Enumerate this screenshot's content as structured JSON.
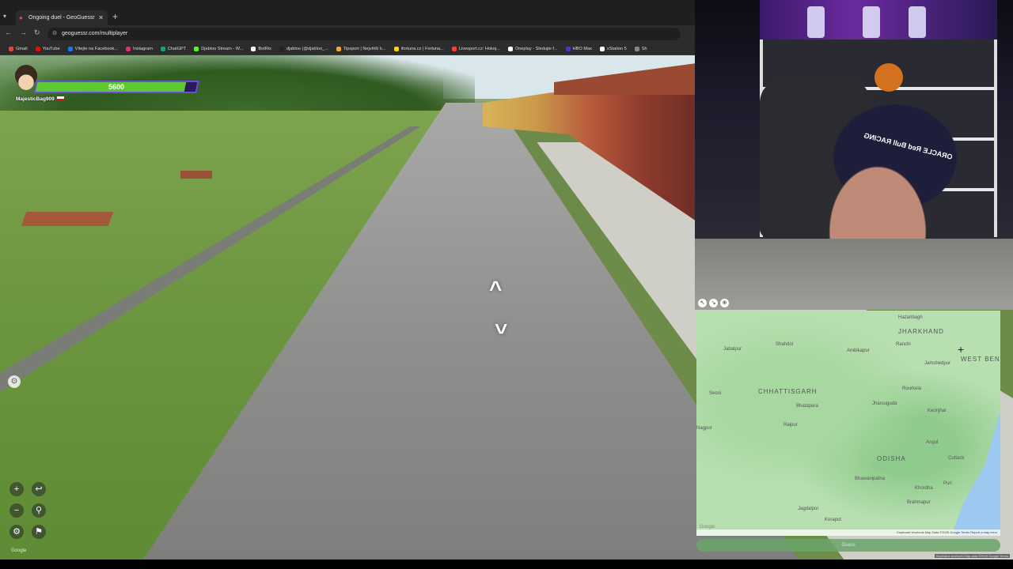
{
  "browser": {
    "tab_title": "Ongoing duel - GeoGuessr",
    "tab_close": "✕",
    "new_tab": "+",
    "url": "geoguessr.com/multiplayer",
    "bookmarks": [
      {
        "label": "Gmail",
        "color": "#ea4335"
      },
      {
        "label": "YouTube",
        "color": "#ff0000"
      },
      {
        "label": "Vítejte na Facebook...",
        "color": "#1877f2"
      },
      {
        "label": "Instagram",
        "color": "#e1306c"
      },
      {
        "label": "ChatGPT",
        "color": "#10a37f"
      },
      {
        "label": "Djabloo Stream - W...",
        "color": "#53fc18"
      },
      {
        "label": "BotRix",
        "color": "#ffffff"
      },
      {
        "label": "djabloo (@djabloo_...",
        "color": "#222222"
      },
      {
        "label": "Tipsport | Největší k...",
        "color": "#f5a623"
      },
      {
        "label": "ifortuna.cz | Fortuna...",
        "color": "#ffd200"
      },
      {
        "label": "Livesport.cz: Hokej...",
        "color": "#ff3b30"
      },
      {
        "label": "Oneplay - Sledujte f...",
        "color": "#ffffff"
      },
      {
        "label": "HBO Max",
        "color": "#5a2dd6"
      },
      {
        "label": "xStation 5",
        "color": "#ffffff"
      },
      {
        "label": "Sh",
        "color": "#888888"
      }
    ]
  },
  "hud": {
    "health_value": "5600",
    "health_fraction": 0.93,
    "player_name": "MajesticBag909",
    "colors": {
      "health_fill": "#5cc832",
      "bar_border": "#6b4dd6"
    }
  },
  "webcam": {
    "cap_text": "ORACLE Red Bull RACING"
  },
  "map": {
    "labels": [
      {
        "text": "Hazaribagh",
        "kind": "city"
      },
      {
        "text": "JHARKHAND",
        "kind": "region"
      },
      {
        "text": "Ranchi",
        "kind": "city"
      },
      {
        "text": "WEST BENG",
        "kind": "region"
      },
      {
        "text": "Jabalpur",
        "kind": "city"
      },
      {
        "text": "Shahdol",
        "kind": "city"
      },
      {
        "text": "Ambikapur",
        "kind": "city"
      },
      {
        "text": "Jamshedpur",
        "kind": "city"
      },
      {
        "text": "CHHATTISGARH",
        "kind": "region"
      },
      {
        "text": "Rourkela",
        "kind": "city"
      },
      {
        "text": "Seoni",
        "kind": "city"
      },
      {
        "text": "Bhatapara",
        "kind": "city"
      },
      {
        "text": "Jharsuguda",
        "kind": "city"
      },
      {
        "text": "Keonjhar",
        "kind": "city"
      },
      {
        "text": "Nagpur",
        "kind": "city"
      },
      {
        "text": "Raipur",
        "kind": "city"
      },
      {
        "text": "Angul",
        "kind": "city"
      },
      {
        "text": "ODISHA",
        "kind": "region"
      },
      {
        "text": "Cuttack",
        "kind": "city"
      },
      {
        "text": "Bhawanipatna",
        "kind": "city"
      },
      {
        "text": "Khordha",
        "kind": "city"
      },
      {
        "text": "Puri",
        "kind": "city"
      },
      {
        "text": "Brahmapur",
        "kind": "city"
      },
      {
        "text": "Jagdalpur",
        "kind": "city"
      },
      {
        "text": "Koraput",
        "kind": "city"
      }
    ],
    "footer": "Keyboard shortcuts   Map Data ©2026 Google   Terms   Report a map error",
    "google_logo": "Google",
    "guess_label": "Guess"
  },
  "streetview": {
    "google_logo": "Google",
    "keyboard_note": "Keyboard shortcuts   Map data ©2026 Google   Terms"
  }
}
